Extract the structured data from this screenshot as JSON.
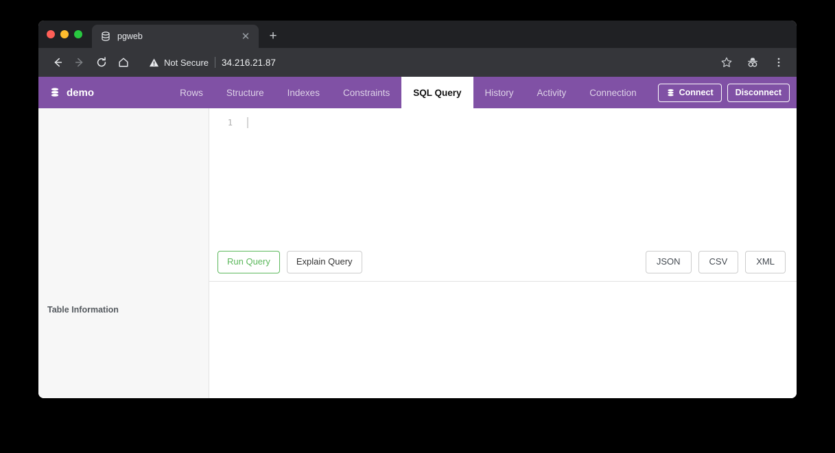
{
  "browser": {
    "tab": {
      "title": "pgweb",
      "favicon_icon": "database-icon",
      "close_icon": "close-icon"
    },
    "new_tab_icon": "plus-icon",
    "toolbar": {
      "back_icon": "arrow-left-icon",
      "forward_icon": "arrow-right-icon",
      "reload_icon": "reload-icon",
      "home_icon": "home-icon",
      "security_icon": "warning-triangle-icon",
      "security_label": "Not Secure",
      "url": "34.216.21.87",
      "bookmark_icon": "star-icon",
      "incognito_icon": "incognito-icon",
      "menu_icon": "three-dots-vertical-icon"
    },
    "traffic_lights": {
      "close_color": "#ff5f57",
      "minimize_color": "#febc2e",
      "maximize_color": "#28c840"
    }
  },
  "app": {
    "navbar": {
      "brand_label": "demo",
      "brand_icon": "database-icon",
      "accent_color": "#8051a5",
      "tabs": [
        {
          "label": "Rows",
          "active": false
        },
        {
          "label": "Structure",
          "active": false
        },
        {
          "label": "Indexes",
          "active": false
        },
        {
          "label": "Constraints",
          "active": false
        },
        {
          "label": "SQL Query",
          "active": true
        },
        {
          "label": "History",
          "active": false
        },
        {
          "label": "Activity",
          "active": false
        },
        {
          "label": "Connection",
          "active": false
        }
      ],
      "connect_label": "Connect",
      "connect_icon": "database-icon",
      "disconnect_label": "Disconnect"
    },
    "sidebar": {
      "table_information_label": "Table Information"
    },
    "editor": {
      "line_numbers": [
        "1"
      ],
      "content": "",
      "caret_visible": true
    },
    "actions": {
      "run_query_label": "Run Query",
      "run_query_color": "#5cb85c",
      "explain_query_label": "Explain Query",
      "export": [
        {
          "label": "JSON"
        },
        {
          "label": "CSV"
        },
        {
          "label": "XML"
        }
      ]
    },
    "results": {
      "rows": [],
      "empty": true
    }
  }
}
